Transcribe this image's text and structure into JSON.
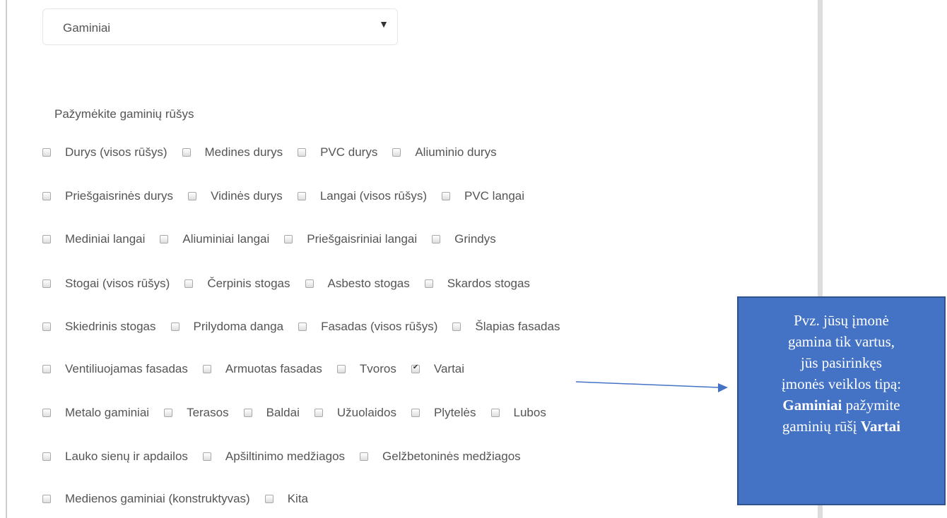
{
  "select": {
    "value": "Gaminiai",
    "caret": "▼"
  },
  "section_label": "Pažymėkite gaminių rūšys",
  "rows": [
    [
      {
        "label": "Durys (visos rūšys)",
        "checked": false
      },
      {
        "label": "Medines durys",
        "checked": false
      },
      {
        "label": "PVC durys",
        "checked": false
      },
      {
        "label": "Aliuminio durys",
        "checked": false
      }
    ],
    [
      {
        "label": "Priešgaisrinės durys",
        "checked": false
      },
      {
        "label": "Vidinės durys",
        "checked": false
      },
      {
        "label": "Langai (visos rūšys)",
        "checked": false
      },
      {
        "label": "PVC langai",
        "checked": false
      }
    ],
    [
      {
        "label": "Mediniai langai",
        "checked": false
      },
      {
        "label": "Aliuminiai langai",
        "checked": false
      },
      {
        "label": "Priešgaisriniai langai",
        "checked": false
      },
      {
        "label": "Grindys",
        "checked": false
      }
    ],
    [
      {
        "label": "Stogai (visos rūšys)",
        "checked": false
      },
      {
        "label": "Čerpinis stogas",
        "checked": false
      },
      {
        "label": "Asbesto stogas",
        "checked": false
      },
      {
        "label": "Skardos stogas",
        "checked": false
      }
    ],
    [
      {
        "label": "Skiedrinis stogas",
        "checked": false
      },
      {
        "label": "Prilydoma danga",
        "checked": false
      },
      {
        "label": "Fasadas (visos rūšys)",
        "checked": false
      },
      {
        "label": "Šlapias fasadas",
        "checked": false
      }
    ],
    [
      {
        "label": "Ventiliuojamas fasadas",
        "checked": false
      },
      {
        "label": "Armuotas fasadas",
        "checked": false
      },
      {
        "label": "Tvoros",
        "checked": false
      },
      {
        "label": "Vartai",
        "checked": true
      }
    ],
    [
      {
        "label": "Metalo gaminiai",
        "checked": false
      },
      {
        "label": "Terasos",
        "checked": false
      },
      {
        "label": "Baldai",
        "checked": false
      },
      {
        "label": "Užuolaidos",
        "checked": false
      },
      {
        "label": "Plytelės",
        "checked": false
      },
      {
        "label": "Lubos",
        "checked": false
      }
    ],
    [
      {
        "label": "Lauko sienų ir apdailos",
        "checked": false
      },
      {
        "label": "Apšiltinimo medžiagos",
        "checked": false
      },
      {
        "label": "Gelžbetoninės medžiagos",
        "checked": false
      }
    ],
    [
      {
        "label": "Medienos gaminiai (konstruktyvas)",
        "checked": false
      },
      {
        "label": "Kita",
        "checked": false
      }
    ]
  ],
  "callout": {
    "line1": "Pvz. jūsų įmonė",
    "line2": "gamina tik vartus,",
    "line3": "jūs pasirinkęs",
    "line4": "įmonės veiklos tipą:",
    "line5_bold": "Gaminiai",
    "line5_rest": " pažymite",
    "line6_rest": "gaminių rūšį ",
    "line6_bold": "Vartai"
  },
  "colors": {
    "callout_bg": "#4472c4",
    "callout_border": "#2f528f",
    "text": "#555555"
  }
}
